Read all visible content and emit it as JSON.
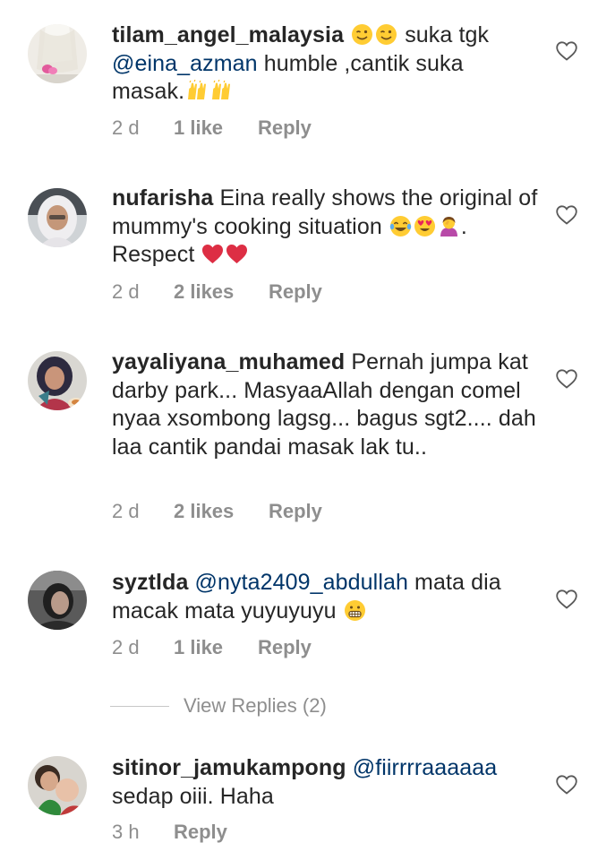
{
  "comments": [
    {
      "username": "tilam_angel_malaysia",
      "text_parts": [
        "suka tgk",
        "@eina_azman",
        " humble ,cantik suka masak."
      ],
      "emojis": [
        "winking-face-emoji",
        "winking-face-emoji",
        "raising-hands-emoji",
        "raising-hands-emoji"
      ],
      "time": "2 d",
      "likes": "1 like",
      "reply": "Reply"
    },
    {
      "username": "nufarisha",
      "text_parts": [
        "Eina really shows the original of mummy's cooking situation",
        ". Respect"
      ],
      "emojis": [
        "tears-of-joy-emoji",
        "heart-eyes-emoji",
        "woman-facepalming-emoji",
        "red-heart-emoji",
        "red-heart-emoji"
      ],
      "time": "2 d",
      "likes": "2 likes",
      "reply": "Reply"
    },
    {
      "username": "yayaliyana_muhamed",
      "text_parts": [
        "Pernah jumpa kat darby park... MasyaaAllah dengan comel nyaa xsombong lagsg... bagus sgt2.... dah laa cantik pandai masak lak tu.."
      ],
      "emojis": [],
      "time": "2 d",
      "likes": "2 likes",
      "reply": "Reply"
    },
    {
      "username": "syztlda",
      "text_parts": [
        "@nyta2409_abdullah",
        " mata dia macak mata yuyuyuyu"
      ],
      "emojis": [
        "grimacing-face-emoji"
      ],
      "time": "2 d",
      "likes": "1 like",
      "reply": "Reply"
    },
    {
      "username": "sitinor_jamukampong",
      "text_parts": [
        "@fiirrrraaaaaa",
        "sedap oiii. Haha"
      ],
      "emojis": [],
      "time": "3 h",
      "likes": "",
      "reply": "Reply"
    }
  ],
  "view_replies": "View Replies (2)",
  "icons": {
    "like": "heart-outline-icon"
  },
  "colors": {
    "text": "#262626",
    "mention": "#003569",
    "meta": "#8e8e8e",
    "divider": "#c7c7c7"
  }
}
